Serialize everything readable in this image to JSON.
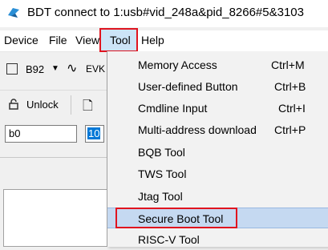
{
  "window": {
    "title": "BDT connect to 1:usb#vid_248a&pid_8266#5&3103"
  },
  "menubar": {
    "items": [
      "Device",
      "File",
      "View",
      "Tool",
      "Help"
    ]
  },
  "toolbar": {
    "chip_label": "B92",
    "evk_label": "EVK",
    "unlock_label": "Unlock",
    "addr_value": "b0",
    "len_value": "10"
  },
  "tool_menu": {
    "items": [
      {
        "label": "Memory Access",
        "shortcut": "Ctrl+M"
      },
      {
        "label": "User-defined Button",
        "shortcut": "Ctrl+B"
      },
      {
        "label": "Cmdline Input",
        "shortcut": "Ctrl+I"
      },
      {
        "label": "Multi-address download",
        "shortcut": "Ctrl+P"
      },
      {
        "label": "BQB Tool",
        "shortcut": ""
      },
      {
        "label": "TWS Tool",
        "shortcut": ""
      },
      {
        "label": "Jtag Tool",
        "shortcut": ""
      },
      {
        "label": "Secure Boot Tool",
        "shortcut": ""
      },
      {
        "label": "RISC-V Tool",
        "shortcut": ""
      }
    ],
    "highlighted": "Secure Boot Tool"
  },
  "colors": {
    "annotation_red": "#e0141f",
    "highlight_blue": "#c5d9f1",
    "selection_blue": "#0078d7"
  }
}
